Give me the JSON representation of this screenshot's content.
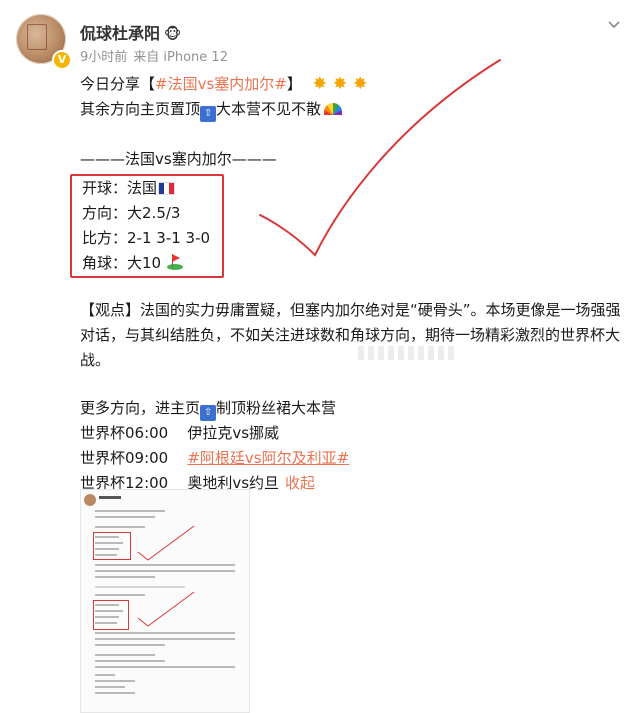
{
  "header": {
    "user_name": "侃球杜承阳",
    "name_emoji": "🐵",
    "time": "9小时前",
    "source": "来自 iPhone 12"
  },
  "post": {
    "line1": {
      "prefix": "今日分享【",
      "topic": "#法国vs塞内加尔#",
      "suffix": "】",
      "stars": [
        "✸",
        "✸",
        "✸"
      ]
    },
    "line2_a": "其余方向主页置顶",
    "line2_b": "大本营不见不散",
    "match_heading": "———法国vs塞内加尔———",
    "boxed": [
      {
        "label": "开球：",
        "value": "法国"
      },
      {
        "label": "方向：",
        "value": "大2.5/3"
      },
      {
        "label": "比方：",
        "value": "2-1 3-1 3-0"
      },
      {
        "label": "角球：",
        "value": "大10"
      }
    ],
    "viewpoint": "【观点】法国的实力毋庸置疑，但塞内加尔绝对是“硬骨头”。本场更像是一场强强对话，与其纠结胜负，不如关注进球数和角球方向，期待一场精彩激烈的世界杯大战。",
    "more_a": "更多方向，进主页",
    "more_b": "制顶粉丝裙大本营",
    "schedule": [
      {
        "time": "世界杯06:00",
        "match": "伊拉克vs挪威",
        "topic": false
      },
      {
        "time": "世界杯09:00",
        "match": "#阿根廷vs阿尔及利亚#",
        "topic": true
      },
      {
        "time": "世界杯12:00",
        "match": "奥地利vs约旦",
        "topic": false
      }
    ],
    "collapse_label": "收起"
  },
  "colors": {
    "topic": "#eb7350",
    "box_border": "#d9373a",
    "check_stroke": "#d9373a",
    "badge": "#f5b400"
  }
}
